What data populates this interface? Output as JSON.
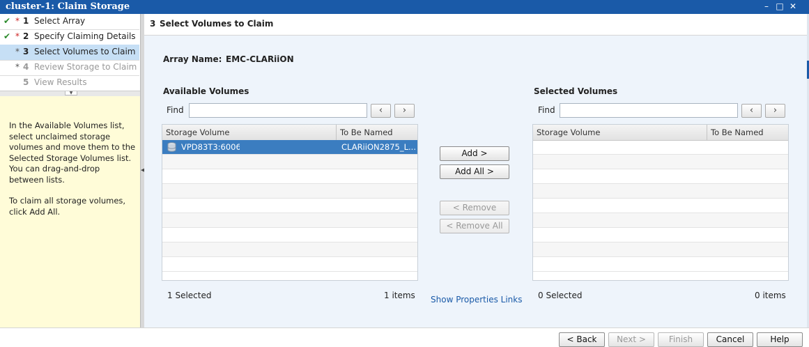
{
  "window": {
    "title": "cluster-1: Claim Storage",
    "controls": [
      "minimize-icon",
      "maximize-icon",
      "close-icon"
    ]
  },
  "steps": [
    {
      "done": true,
      "required": true,
      "num": "1",
      "label": "Select Array"
    },
    {
      "done": true,
      "required": true,
      "num": "2",
      "label": "Specify Claiming Details"
    },
    {
      "done": false,
      "required": true,
      "num": "3",
      "label": "Select Volumes to Claim",
      "active": true
    },
    {
      "done": false,
      "required": true,
      "num": "4",
      "label": "Review Storage to Claim"
    },
    {
      "done": false,
      "required": false,
      "num": "5",
      "label": "View Results"
    }
  ],
  "help": {
    "para1": "In the Available Volumes list, select unclaimed storage volumes and move them to the Selected Storage Volumes list. You can drag-and-drop between lists.",
    "para2": "To claim all storage volumes, click Add All."
  },
  "header": {
    "num": "3",
    "title": "Select Volumes to Claim"
  },
  "array": {
    "label": "Array Name:",
    "value": "EMC-CLARiiON-("
  },
  "available": {
    "title": "Available Volumes",
    "find_label": "Find",
    "find_value": "",
    "columns": [
      "Storage Volume",
      "To Be Named"
    ],
    "rows": [
      {
        "volume": "VPD83T3:6006(",
        "name": "CLARiiON2875_L...",
        "selected": true
      }
    ],
    "selected_count": "1 Selected",
    "item_count": "1 items"
  },
  "selected": {
    "title": "Selected Volumes",
    "find_label": "Find",
    "find_value": "",
    "columns": [
      "Storage Volume",
      "To Be Named"
    ],
    "rows": [],
    "selected_count": "0 Selected",
    "item_count": "0 items"
  },
  "transfer": {
    "add": "Add >",
    "add_all": "Add All >",
    "remove": "< Remove",
    "remove_all": "< Remove All"
  },
  "links": {
    "show_properties": "Show Properties Links"
  },
  "footer": {
    "back": "< Back",
    "next": "Next >",
    "finish": "Finish",
    "cancel": "Cancel",
    "help": "Help"
  },
  "colors": {
    "titlebar": "#1a5aa8",
    "active_step": "#c6dff5",
    "help_bg": "#fffcd8",
    "selection": "#3b7dc0"
  }
}
